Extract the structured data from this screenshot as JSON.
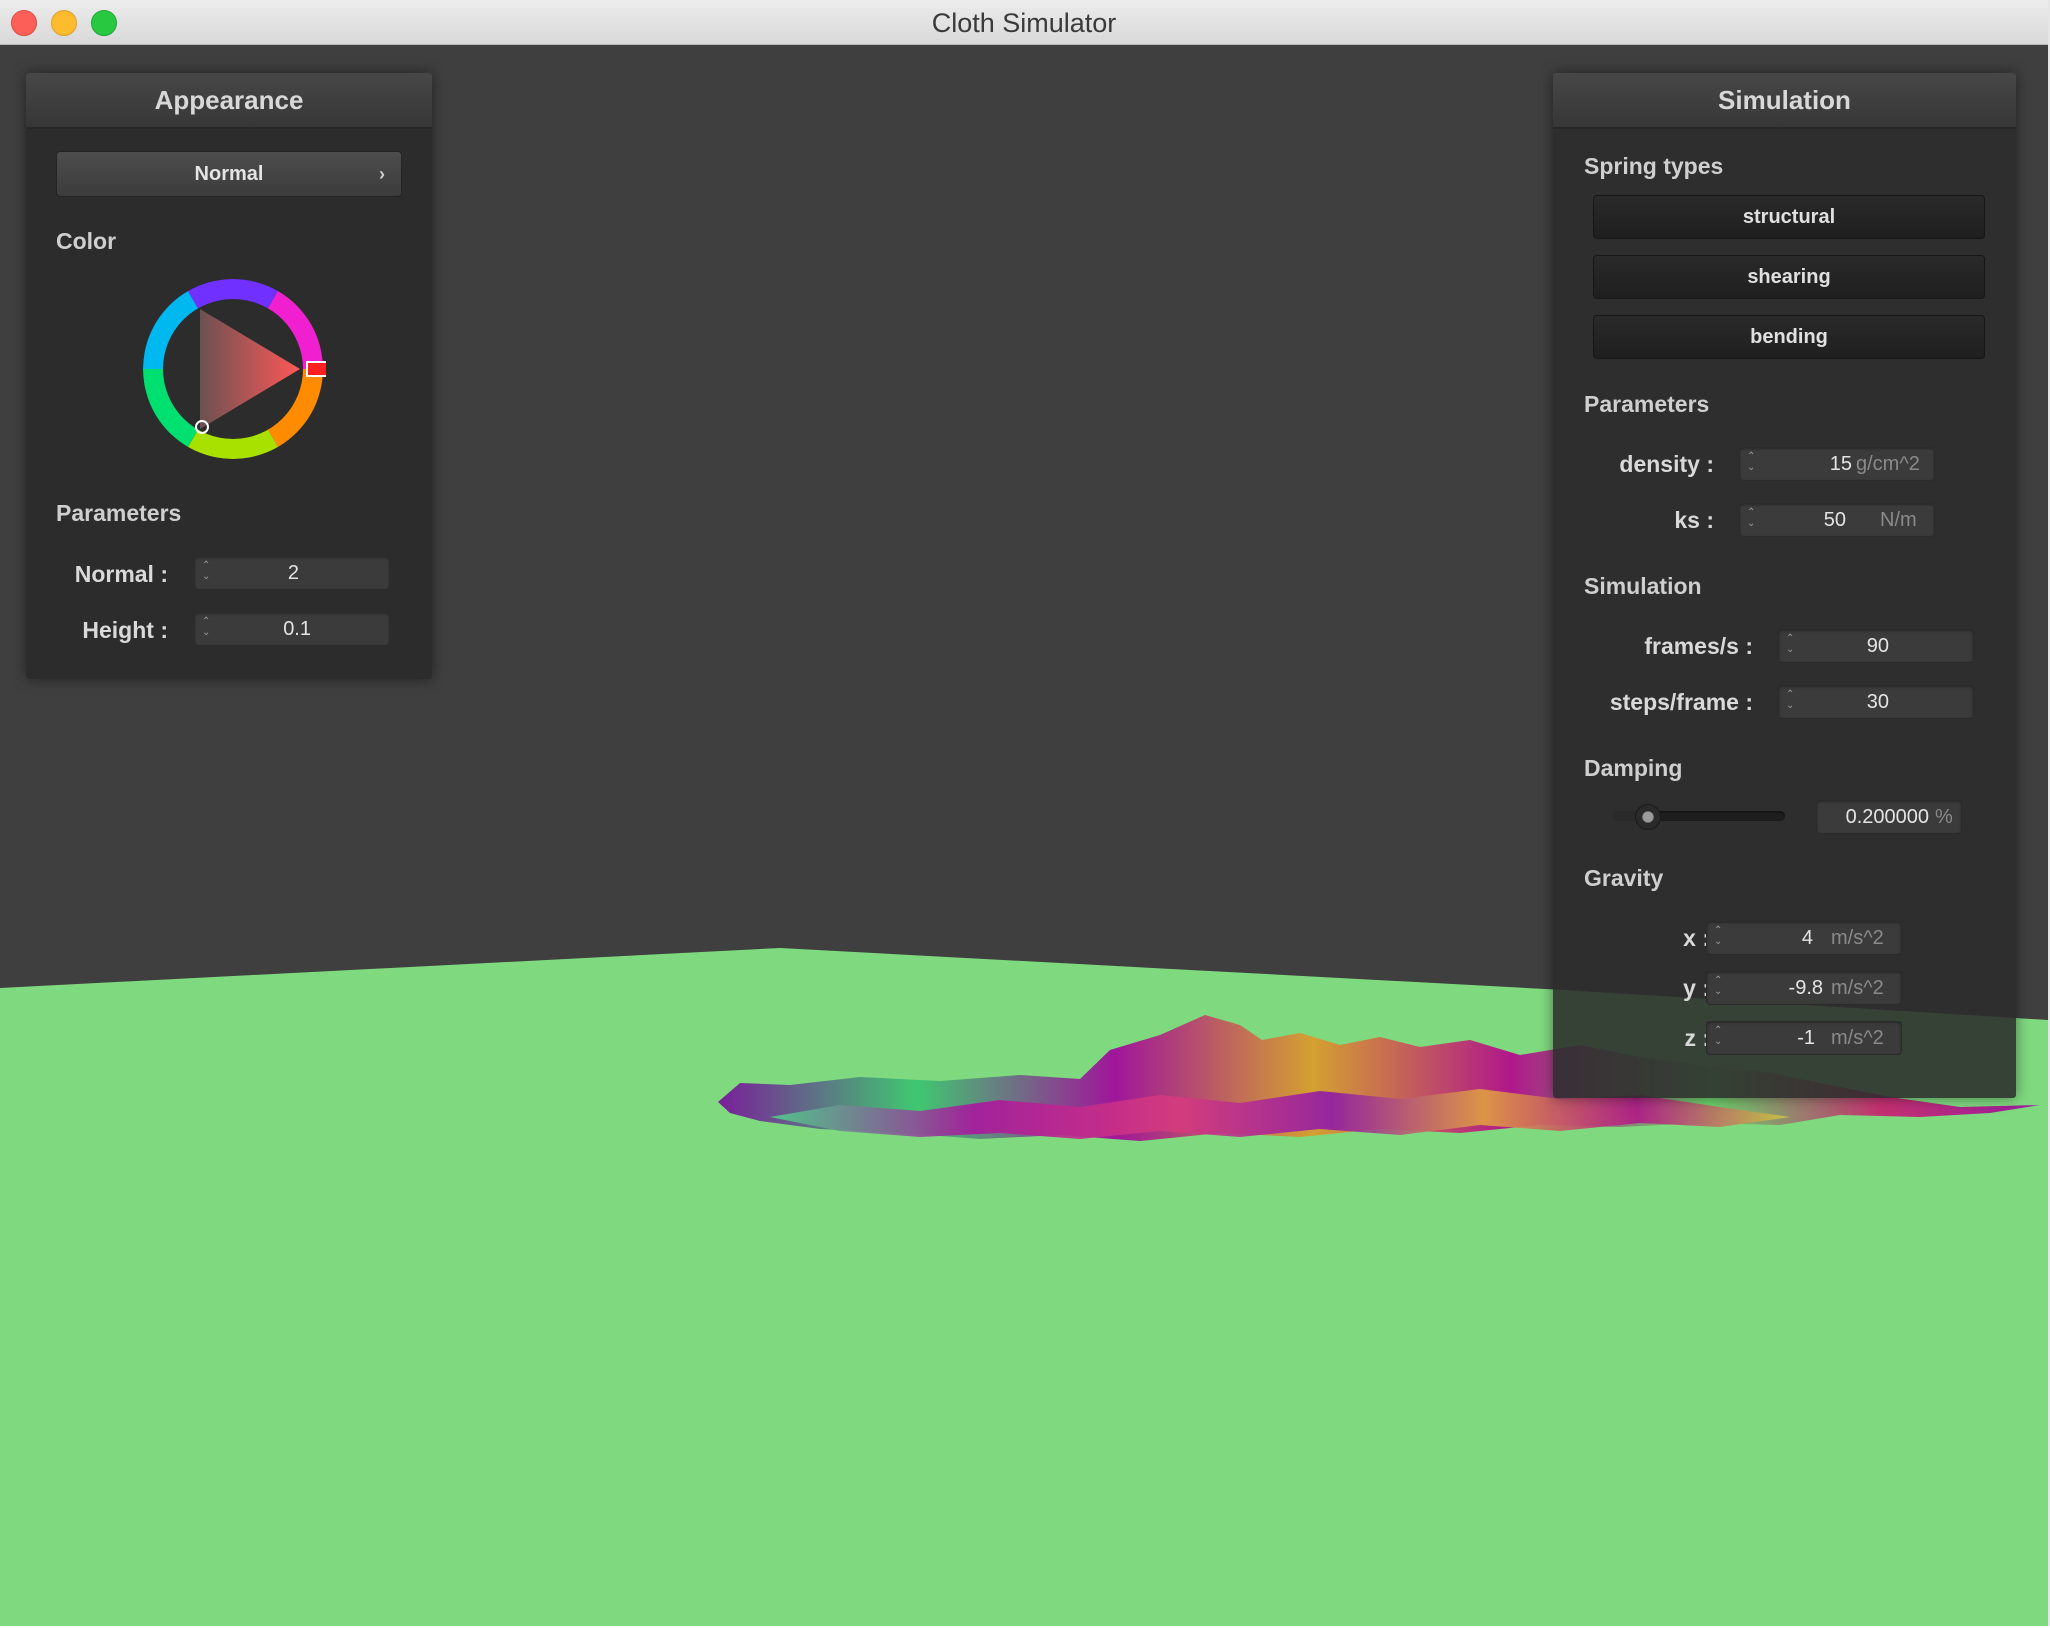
{
  "window": {
    "title": "Cloth Simulator"
  },
  "appearance": {
    "header": "Appearance",
    "shader_dropdown": "Normal",
    "color_section": "Color",
    "selected_color": "#ff0000",
    "params_section": "Parameters",
    "normal_label": "Normal :",
    "normal_value": "2",
    "height_label": "Height :",
    "height_value": "0.1"
  },
  "simulation": {
    "header": "Simulation",
    "spring_types_section": "Spring types",
    "spring_buttons": [
      "structural",
      "shearing",
      "bending"
    ],
    "params_section": "Parameters",
    "density_label": "density :",
    "density_value": "15",
    "density_unit": "g/cm^2",
    "ks_label": "ks :",
    "ks_value": "50",
    "ks_unit": "N/m",
    "sim_section": "Simulation",
    "fps_label": "frames/s :",
    "fps_value": "90",
    "steps_label": "steps/frame :",
    "steps_value": "30",
    "damping_section": "Damping",
    "damping_value": "0.200000",
    "damping_unit": "%",
    "damping_slider_fraction": 0.2,
    "gravity_section": "Gravity",
    "gx_label": "x :",
    "gx_value": "4",
    "gy_label": "y :",
    "gy_value": "-9.8",
    "gz_label": "z :",
    "gz_value": "-1",
    "gravity_unit": "m/s^2"
  },
  "colors": {
    "ground": "#7fd97f",
    "background": "#3f3f3f"
  }
}
